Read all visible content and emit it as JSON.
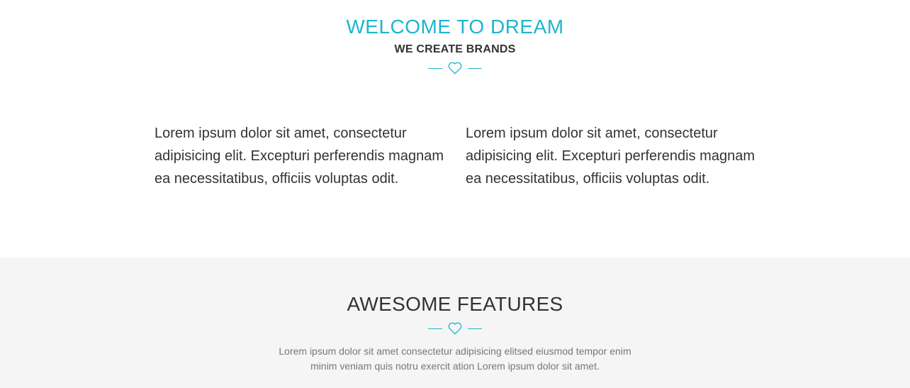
{
  "welcome": {
    "title": "WELCOME TO DREAM",
    "subtitle": "WE CREATE BRANDS",
    "divider_icon": "heart-icon",
    "columns": [
      "Lorem ipsum dolor sit amet, consectetur adipisicing elit. Excepturi perferendis magnam ea necessitatibus, officiis voluptas odit.",
      "Lorem ipsum dolor sit amet, consectetur adipisicing elit. Excepturi perferendis magnam ea necessitatibus, officiis voluptas odit."
    ]
  },
  "features": {
    "title": "AWESOME FEATURES",
    "divider_icon": "heart-icon",
    "description": "Lorem ipsum dolor sit amet consectetur adipisicing elitsed eiusmod tempor enim minim veniam quis notru exercit ation Lorem ipsum dolor sit amet."
  },
  "colors": {
    "accent": "#1eb5cc",
    "text": "#333333",
    "muted_text": "#777777",
    "section_bg": "#f5f5f5"
  }
}
